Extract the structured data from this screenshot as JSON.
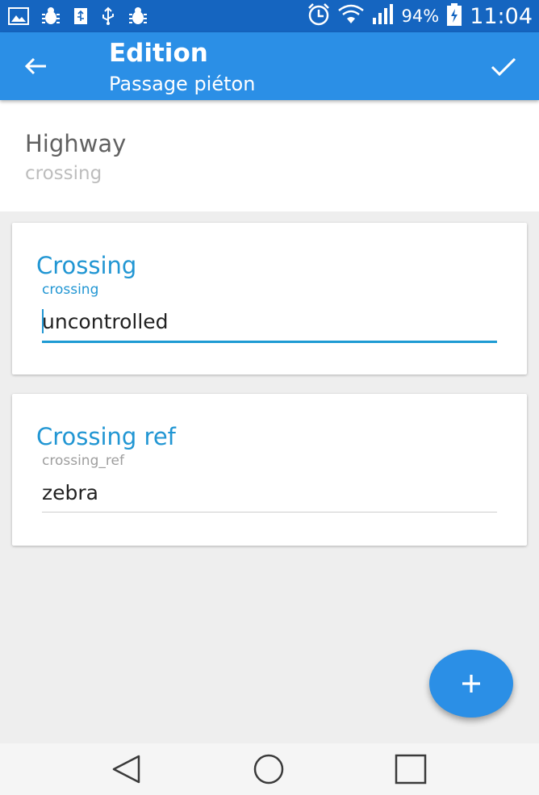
{
  "status_bar": {
    "notification_icons": [
      "gallery-icon",
      "bug-icon",
      "sd-card-icon",
      "usb-icon",
      "bug-icon"
    ],
    "system_icons": [
      "alarm-icon",
      "wifi-icon",
      "signal-icon",
      "battery-charging-icon"
    ],
    "battery_percent": "94%",
    "time": "11:04"
  },
  "toolbar": {
    "back_icon": "arrow-left-icon",
    "title": "Edition",
    "subtitle": "Passage piéton",
    "confirm_icon": "check-icon"
  },
  "highway": {
    "label": "Highway",
    "value": "crossing"
  },
  "fields": [
    {
      "title": "Crossing",
      "key": "crossing",
      "value": "uncontrolled",
      "focused": true
    },
    {
      "title": "Crossing ref",
      "key": "crossing_ref",
      "value": "zebra",
      "focused": false
    }
  ],
  "fab": {
    "icon": "plus-icon"
  },
  "nav_bar": {
    "icons": [
      "nav-back-icon",
      "nav-home-icon",
      "nav-recents-icon"
    ]
  },
  "colors": {
    "status_bar": "#1565c0",
    "toolbar": "#2b8fe6",
    "accent": "#2196d3",
    "background": "#eeeeee"
  }
}
